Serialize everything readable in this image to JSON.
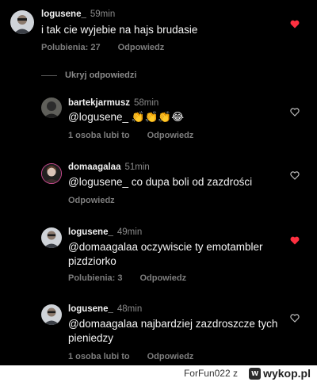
{
  "top_comment": {
    "username": "logusene_",
    "time": "59min",
    "text": "i tak cie wyjebie na hajs brudasie",
    "likes": "Polubienia: 27",
    "reply": "Odpowiedz",
    "liked": true
  },
  "hide_replies": "Ukryj odpowiedzi",
  "replies": [
    {
      "username": "bartekjarmusz",
      "time": "58min",
      "text": "@logusene_ 👏👏👏😂",
      "likes": "1 osoba lubi to",
      "reply": "Odpowiedz",
      "liked": false
    },
    {
      "username": "domaagalaa",
      "time": "51min",
      "text": "@logusene_ co dupa boli od zazdrości",
      "likes": "",
      "reply": "Odpowiedz",
      "liked": false
    },
    {
      "username": "logusene_",
      "time": "49min",
      "text": "@domaagalaa oczywiscie ty emotambler pizdziorko",
      "likes": "Polubienia: 3",
      "reply": "Odpowiedz",
      "liked": true
    },
    {
      "username": "logusene_",
      "time": "48min",
      "text": "@domaagalaa najbardziej zazdroszcze tych pieniedzy",
      "likes": "1 osoba lubi to",
      "reply": "Odpowiedz",
      "liked": false
    }
  ],
  "colors": {
    "liked_heart": "#ff3040",
    "background": "#000000",
    "muted_text": "#7d7d7d"
  },
  "footer": {
    "credit": "ForFun022",
    "separator": "z",
    "brand": "wykop.pl"
  }
}
